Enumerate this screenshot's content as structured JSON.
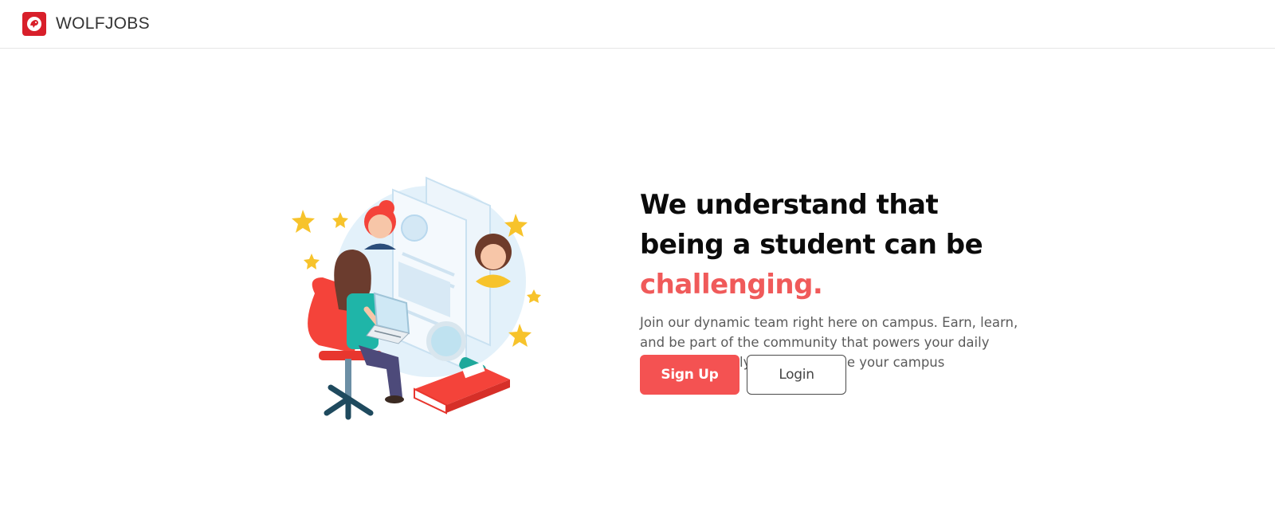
{
  "navbar": {
    "brand_name": "WOLFJOBS",
    "logo_icon": "wolf-logo-icon",
    "brand_color": "#d81f2a"
  },
  "hero": {
    "headline_part1": "We understand that being a student can be ",
    "headline_accent": "challenging.",
    "description": "Join our dynamic team right here on campus. Earn, learn, and be part of the community that powers your daily essentials. Apply now and shape your campus experience!",
    "accent_color": "#f05a5a",
    "illustration": "student-job-search-illustration"
  },
  "actions": {
    "signup_label": "Sign Up",
    "login_label": "Login",
    "primary_color": "#f45252"
  }
}
